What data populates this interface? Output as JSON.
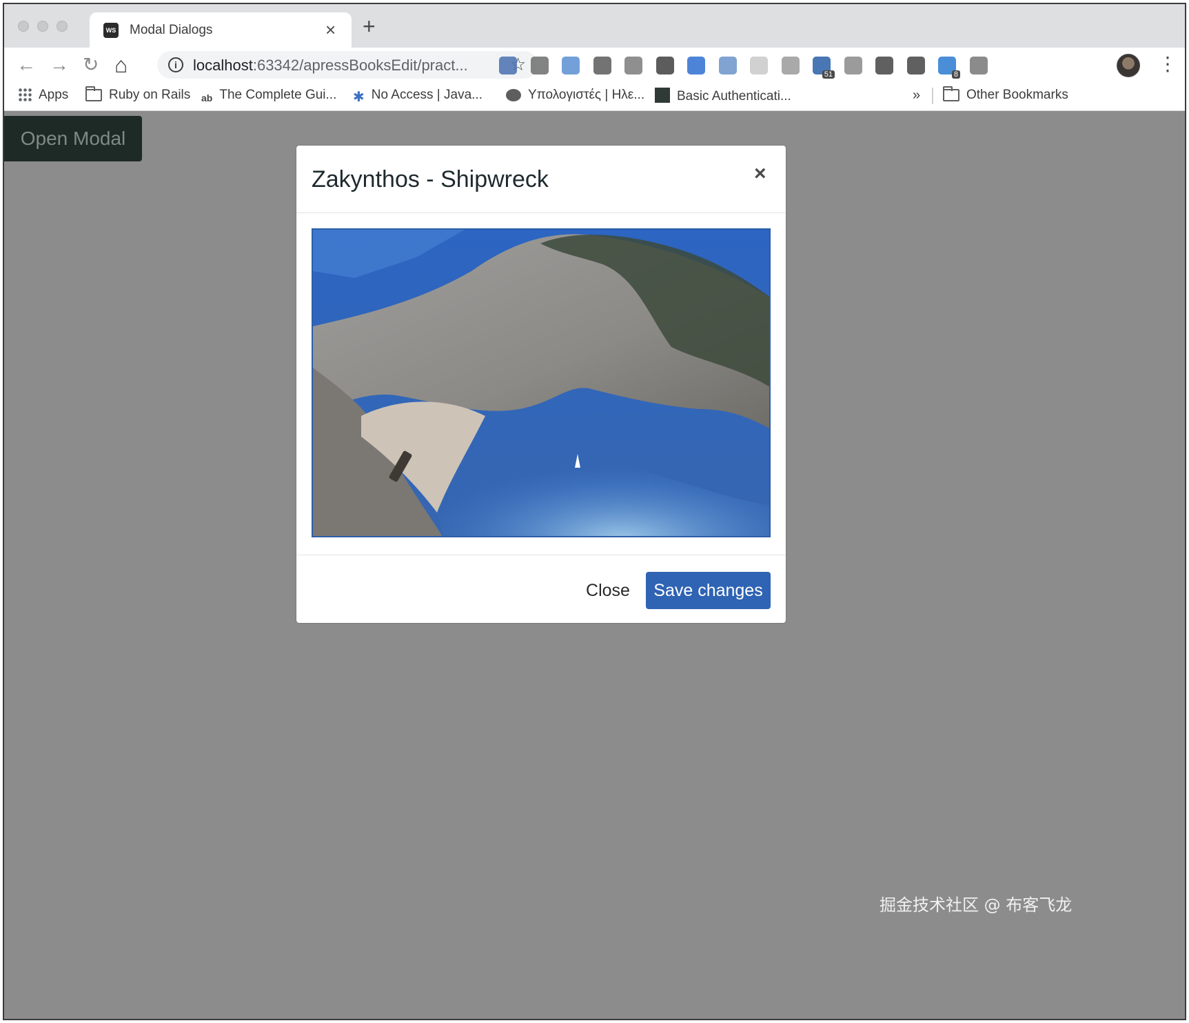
{
  "browser": {
    "tab": {
      "title": "Modal Dialogs",
      "close_glyph": "×"
    },
    "new_tab_glyph": "+",
    "nav": {
      "back": "←",
      "forward": "→",
      "reload": "↻",
      "home": "⌂"
    },
    "omnibox": {
      "info_glyph": "i",
      "host": "localhost",
      "path": ":63342/apressBooksEdit/pract...",
      "star_glyph": "☆"
    },
    "menu_glyph": "⋮",
    "extensions": [
      {
        "name": "eyedropper-extension-icon",
        "color": "#4a6fb0"
      },
      {
        "name": "network-extension-icon",
        "color": "#6d6d6d"
      },
      {
        "name": "globe-extension-icon",
        "color": "#5b8fd1"
      },
      {
        "name": "c-extension-icon",
        "color": "#5a5a5a"
      },
      {
        "name": "gear-extension-icon",
        "color": "#7b7b7b"
      },
      {
        "name": "lightbulb-extension-icon",
        "color": "#3f3f3f"
      },
      {
        "name": "download-extension-icon",
        "color": "#2f6fd1"
      },
      {
        "name": "window-extension-icon",
        "color": "#6a93c9"
      },
      {
        "name": "grid-extension-icon",
        "color": "#c9c9c9"
      },
      {
        "name": "chat-extension-icon",
        "color": "#9a9a9a"
      },
      {
        "name": "counter-extension-icon",
        "color": "#2a5fa8",
        "badge": "51"
      },
      {
        "name": "globe-lock-extension-icon",
        "color": "#8a8a8a"
      },
      {
        "name": "a-circle-extension-icon",
        "color": "#444444"
      },
      {
        "name": "move-extension-icon",
        "color": "#444444"
      },
      {
        "name": "e-extension-icon",
        "color": "#2a7bd1",
        "badge": "8"
      },
      {
        "name": "cast-extension-icon",
        "color": "#777777"
      }
    ],
    "bookmarks": [
      {
        "label": "Apps",
        "icon": "apps-icon"
      },
      {
        "label": "Ruby on Rails",
        "icon": "folder-icon"
      },
      {
        "label": "The Complete Gui...",
        "icon": "ab-icon"
      },
      {
        "label": "No Access | Java...",
        "icon": "molecule-icon"
      },
      {
        "label": "Υπολογιστές | Ηλε...",
        "icon": "balloon-icon"
      },
      {
        "label": "Basic Authenticati...",
        "icon": "dark-square-icon"
      }
    ],
    "bookmarks_overflow": "»",
    "other_bookmarks": "Other Bookmarks"
  },
  "page": {
    "open_modal_label": "Open Modal",
    "modal": {
      "title": "Zakynthos - Shipwreck",
      "close_x": "×",
      "image_subject": "aerial photo of shipwreck beach cove",
      "close_label": "Close",
      "save_label": "Save changes"
    },
    "watermark": "掘金技术社区 @ 布客飞龙"
  },
  "colors": {
    "backdrop": "#8c8c8c",
    "primary": "#2f63b3",
    "open_modal_bg": "#1e2a26"
  }
}
